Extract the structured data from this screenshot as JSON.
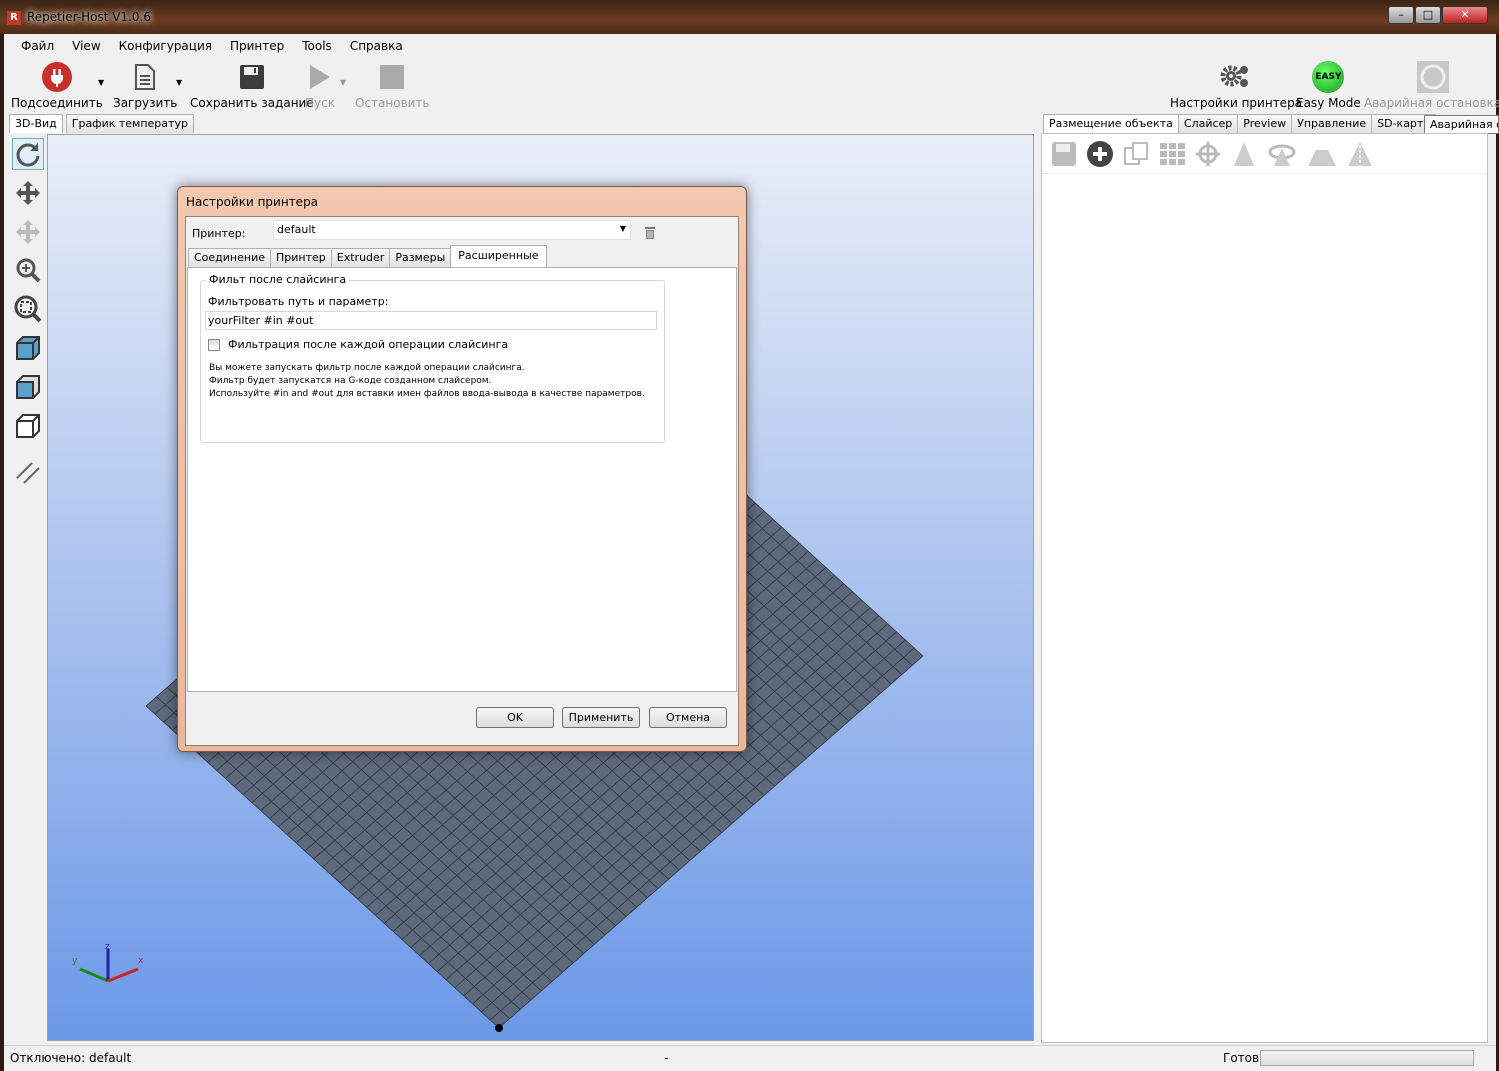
{
  "window": {
    "title": "Repetier-Host V1.0.6",
    "app_icon": "R"
  },
  "menu": [
    "Файл",
    "View",
    "Конфигурация",
    "Принтер",
    "Tools",
    "Справка"
  ],
  "toolbar": {
    "connect": "Подсоединить",
    "load": "Загрузить",
    "save_job": "Сохранить задание",
    "run": "Пуск",
    "stop": "Остановить",
    "printer_settings": "Настройки принтера",
    "easy_mode": "Easy Mode",
    "easy_badge": "EASY",
    "emergency_stop": "Аварийная остановка"
  },
  "left_tabs": [
    "3D-Вид",
    "График температур"
  ],
  "right_tabs": [
    "Размещение объекта",
    "Слайсер",
    "Preview",
    "Управление",
    "SD-карта"
  ],
  "right_tooltip": "Аварийная о",
  "dialog": {
    "title": "Настройки принтера",
    "printer_label": "Принтер:",
    "printer_value": "default",
    "tabs": [
      "Соединение",
      "Принтер",
      "Extruder",
      "Размеры",
      "Расширенные"
    ],
    "group_title": "Фильт после слайсинга",
    "filter_label": "Фильтровать путь и параметр:",
    "filter_value": "yourFilter #in #out",
    "checkbox_label": "Фильтрация после каждой операции слайсинга",
    "checkbox_checked": false,
    "help": [
      "Вы можете запускать фильтр после каждой операции слайсинга.",
      "Фильтр будет запускатся на G-коде созданном слайсером.",
      "Используйте #in and #out для вставки имен файлов ввода-вывода в качестве параметров."
    ],
    "ok": "OK",
    "apply": "Применить",
    "cancel": "Отмена"
  },
  "status": {
    "left": "Отключено: default",
    "middle": "-",
    "right": "Готов",
    "progress": 0
  }
}
